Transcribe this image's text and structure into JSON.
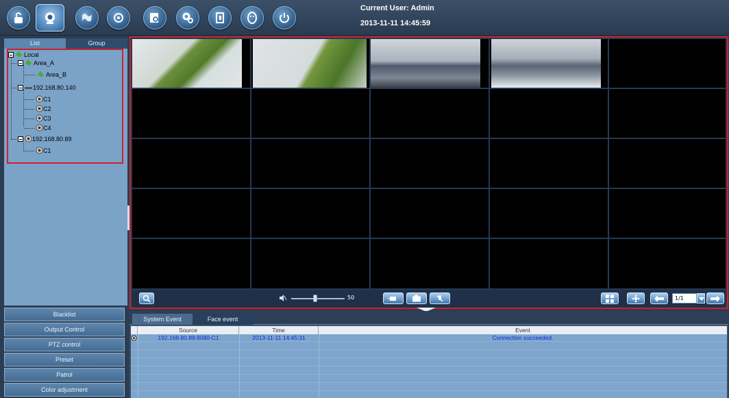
{
  "header": {
    "current_user": "Current User: Admin",
    "datetime": "2013-11-11 14:45:59",
    "toolbar_icons": [
      "lock-icon",
      "camera-icon",
      "world-map-icon",
      "network-icon",
      "search-log-icon",
      "settings-icon",
      "logout-door-icon",
      "face-icon",
      "power-icon"
    ],
    "accent": "#4f86bb"
  },
  "left_panel": {
    "tabs": [
      "List",
      "Group"
    ],
    "tree": {
      "local": "Local",
      "area_a": "Area_A",
      "area_b": "Area_B",
      "device1": "192.168.80.140",
      "device1_channels": [
        "C1",
        "C2",
        "C3",
        "C4"
      ],
      "device2": "192.168.80.89",
      "device2_channels": [
        "C1"
      ]
    },
    "buttons": [
      "Blacklist",
      "Output Control",
      "PTZ control",
      "Preset",
      "Patrol",
      "Color adjustment"
    ]
  },
  "video": {
    "volume": "50",
    "page": "1/1"
  },
  "events": {
    "tabs": [
      "System Event",
      "Face event"
    ],
    "columns": [
      "Source",
      "Time",
      "Event"
    ],
    "rows": [
      {
        "source": "192.168.80.89:8080-C1",
        "time": "2013-11-11 14:45:31",
        "event": "Connection succeeded."
      }
    ]
  }
}
